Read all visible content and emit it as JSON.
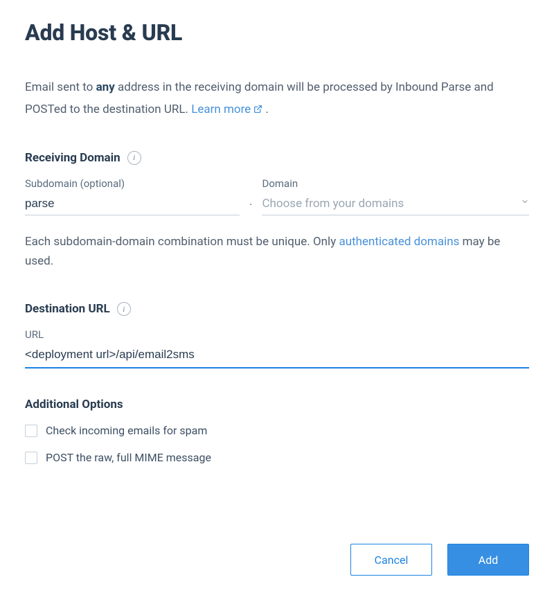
{
  "title": "Add Host & URL",
  "description": {
    "prefix": "Email sent to ",
    "bold": "any",
    "middle": " address in the receiving domain will be processed by Inbound Parse and POSTed to the destination URL. ",
    "link": "Learn more",
    "suffix": " ."
  },
  "receiving_domain": {
    "heading": "Receiving Domain",
    "subdomain_label": "Subdomain (optional)",
    "subdomain_value": "parse",
    "domain_label": "Domain",
    "domain_placeholder": "Choose from your domains"
  },
  "helper": {
    "prefix": "Each subdomain-domain combination must be unique. Only ",
    "link": "authenticated domains",
    "suffix": " may be used."
  },
  "destination_url": {
    "heading": "Destination URL",
    "url_label": "URL",
    "url_value": "<deployment url>/api/email2sms"
  },
  "additional_options": {
    "heading": "Additional Options",
    "spam_label": "Check incoming emails for spam",
    "spam_checked": false,
    "raw_label": "POST the raw, full MIME message",
    "raw_checked": false
  },
  "buttons": {
    "cancel": "Cancel",
    "add": "Add"
  }
}
